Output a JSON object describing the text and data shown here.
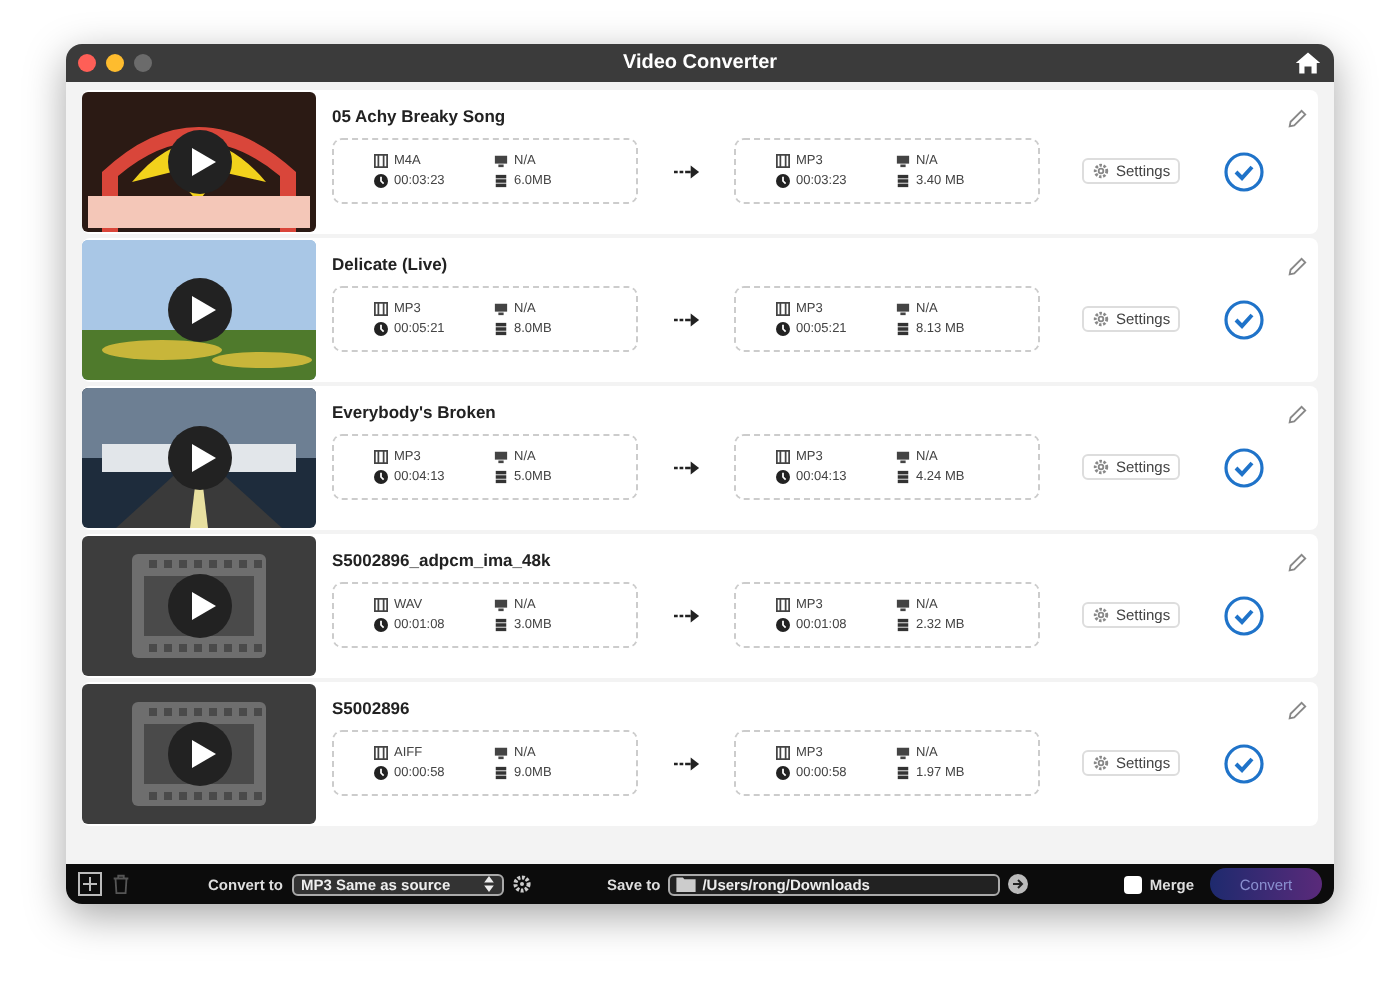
{
  "window": {
    "title": "Video Converter"
  },
  "files": [
    {
      "name": "05 Achy Breaky Song",
      "source": {
        "format": "M4A",
        "resolution": "N/A",
        "duration": "00:03:23",
        "size": "6.0MB"
      },
      "output": {
        "format": "MP3",
        "resolution": "N/A",
        "duration": "00:03:23",
        "size": "3.40 MB"
      },
      "settings_label": "Settings",
      "selected": true
    },
    {
      "name": "Delicate (Live)",
      "source": {
        "format": "MP3",
        "resolution": "N/A",
        "duration": "00:05:21",
        "size": "8.0MB"
      },
      "output": {
        "format": "MP3",
        "resolution": "N/A",
        "duration": "00:05:21",
        "size": "8.13 MB"
      },
      "settings_label": "Settings",
      "selected": true
    },
    {
      "name": "Everybody's Broken",
      "source": {
        "format": "MP3",
        "resolution": "N/A",
        "duration": "00:04:13",
        "size": "5.0MB"
      },
      "output": {
        "format": "MP3",
        "resolution": "N/A",
        "duration": "00:04:13",
        "size": "4.24 MB"
      },
      "settings_label": "Settings",
      "selected": true
    },
    {
      "name": "S5002896_adpcm_ima_48k",
      "thumbnail": {
        "kind": "placeholder"
      },
      "source": {
        "format": "WAV",
        "resolution": "N/A",
        "duration": "00:01:08",
        "size": "3.0MB"
      },
      "output": {
        "format": "MP3",
        "resolution": "N/A",
        "duration": "00:01:08",
        "size": "2.32 MB"
      },
      "settings_label": "Settings",
      "selected": true
    },
    {
      "name": "S5002896",
      "thumbnail": {
        "kind": "placeholder"
      },
      "source": {
        "format": "AIFF",
        "resolution": "N/A",
        "duration": "00:00:58",
        "size": "9.0MB"
      },
      "output": {
        "format": "MP3",
        "resolution": "N/A",
        "duration": "00:00:58",
        "size": "1.97 MB"
      },
      "settings_label": "Settings",
      "selected": true
    }
  ],
  "bottom_bar": {
    "convert_to_label": "Convert to",
    "convert_to_value": "MP3 Same as source",
    "save_to_label": "Save to",
    "save_to_path": "/Users/rong/Downloads",
    "merge": {
      "label": "Merge",
      "checked": false
    },
    "convert_button": "Convert"
  }
}
